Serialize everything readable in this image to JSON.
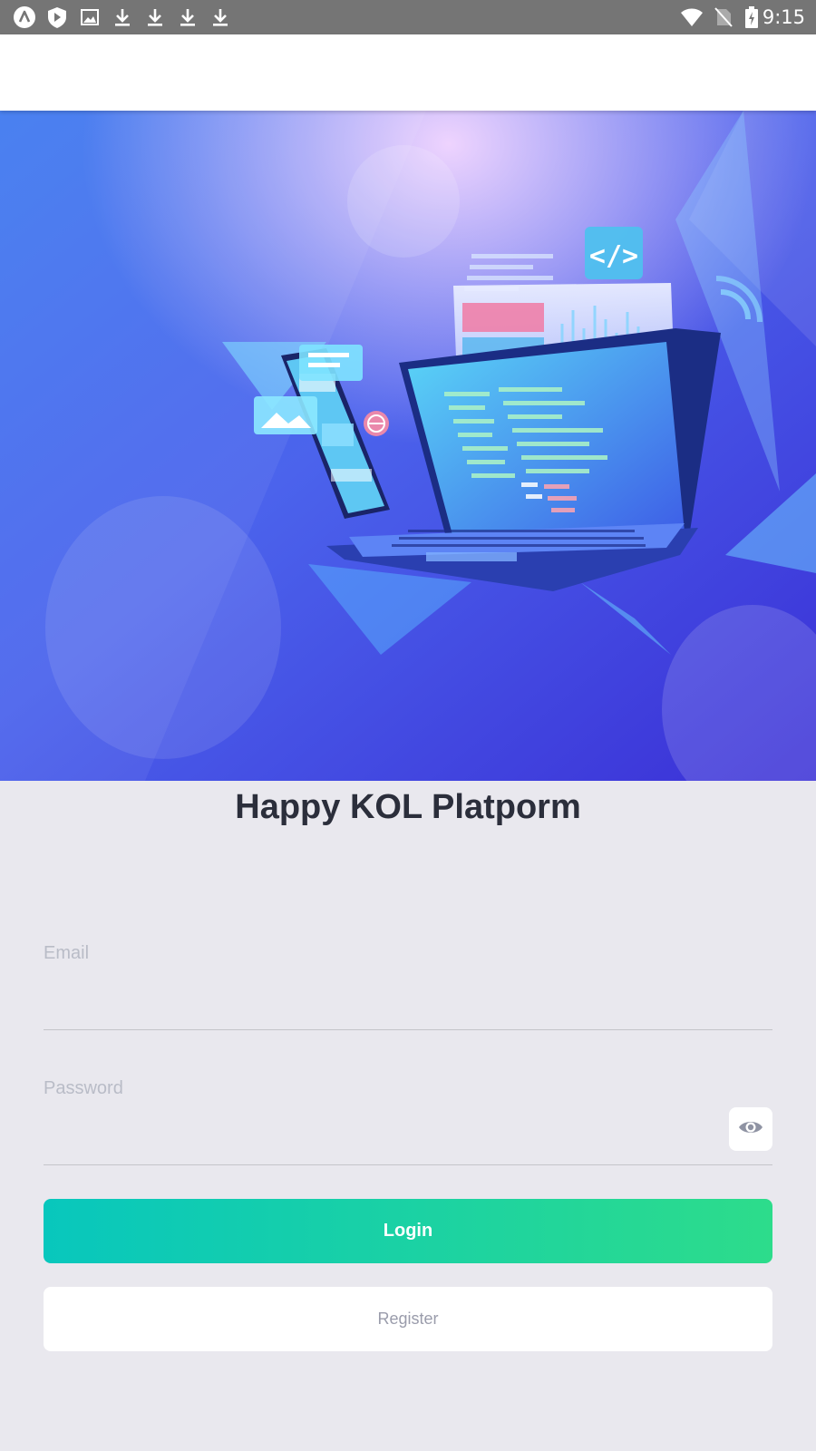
{
  "status_bar": {
    "time": "9:15",
    "left_icons": [
      "app-launcher-icon",
      "play-shield-icon",
      "image-icon",
      "download-icon",
      "download-icon",
      "download-icon",
      "download-icon"
    ],
    "right_icons": [
      "wifi-icon",
      "no-sim-icon",
      "battery-charging-icon"
    ]
  },
  "hero": {
    "illustration": "laptop-and-phone-code-illustration",
    "code_badge_text": "</>"
  },
  "login": {
    "title": "Happy KOL Platporm",
    "email_label": "Email",
    "email_value": "",
    "password_label": "Password",
    "password_value": "",
    "password_toggle_icon": "eye-icon",
    "login_label": "Login",
    "register_label": "Register"
  },
  "colors": {
    "status_bar": "#757575",
    "header": "#ffffff",
    "background": "#e9e8ee",
    "title": "#2b2e3b",
    "login_gradient_start": "#08c7bd",
    "login_gradient_end": "#2ddc8b",
    "register_text": "#9a9cab",
    "hero_blue": "#3b4fe0"
  }
}
